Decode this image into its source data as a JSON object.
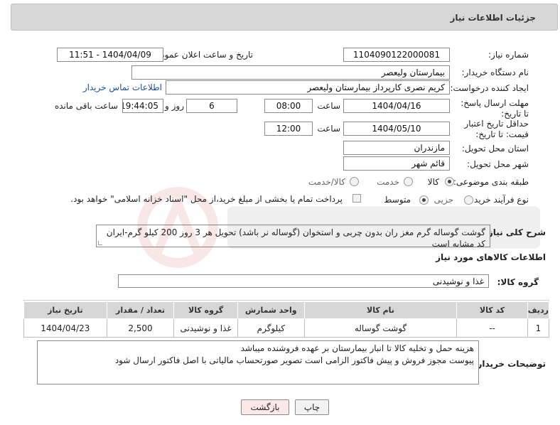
{
  "header": {
    "title": "جزئیات اطلاعات نیاز"
  },
  "fields": {
    "need_number_label": "شماره نیاز:",
    "need_number": "1104090122000081",
    "announce_label": "تاریخ و ساعت اعلان عمومی:",
    "announce_value": "1404/04/09 - 11:51",
    "buyer_org_label": "نام دستگاه خریدار:",
    "buyer_org": "بیمارستان ولیعصر",
    "creator_label": "ایجاد کننده درخواست:",
    "creator": "کریم نصری کارپرداز بیمارستان ولیعصر",
    "contact_link": "اطلاعات تماس خریدار",
    "reply_deadline_label": "مهلت ارسال پاسخ: تا تاریخ:",
    "reply_date": "1404/04/16",
    "time_label": "ساعت",
    "reply_time": "08:00",
    "days_value": "6",
    "days_label": "روز و",
    "remaining_time": "19:44:05",
    "remaining_label": "ساعت باقی مانده",
    "price_validity_label": "حداقل تاریخ اعتبار قیمت: تا تاریخ:",
    "price_date": "1404/05/10",
    "price_time": "12:00",
    "province_label": "استان محل تحویل:",
    "province": "مازندران",
    "city_label": "شهر محل تحویل:",
    "city": "قائم شهر",
    "category_label": "طبقه بندی موضوعی:",
    "category_options": [
      "کالا",
      "خدمت",
      "کالا/خدمت"
    ],
    "process_label": "نوع فرآیند خرید :",
    "process_options": [
      "جزیی",
      "متوسط"
    ],
    "payment_note": "پرداخت تمام یا بخشی از مبلغ خرید،از محل \"اسناد خزانه اسلامی\" خواهد بود."
  },
  "description": {
    "label": "شرح کلی نیاز:",
    "text": "گوشت گوساله گرم مغز ران بدون چربی و استخوان (گوساله نر باشد) تحویل هر 3 روز 200 کیلو گرم-ایران کد مشابه است"
  },
  "goods_info": {
    "title": "اطلاعات کالاهای مورد نیاز",
    "group_label": "گروه کالا:",
    "group_value": "غذا و نوشیدنی"
  },
  "table": {
    "headers": [
      "ردیف",
      "کد کالا",
      "نام کالا",
      "واحد شمارش",
      "گروه کالا",
      "تعداد / مقدار",
      "تاریخ نیاز"
    ],
    "rows": [
      [
        "1",
        "--",
        "گوشت گوساله",
        "کیلوگرم",
        "غذا و نوشیدنی",
        "2,500",
        "1404/04/23"
      ]
    ]
  },
  "buyer_notes": {
    "label": "توضیحات خریدار:",
    "line1": "هزینه حمل و تخلیه کالا تا انبار بیمارستان بر عهده فروشنده میباشد",
    "line2": "پیوست مجوز فروش و پیش فاکتور الزامی است  تصویر صورتحساب مالیاتی با اصل فاکتور ارسال شود"
  },
  "buttons": {
    "print": "چاپ",
    "back": "بازگشت"
  },
  "colors": {
    "header_bg": "#d7d7d7",
    "link": "#1a4fa0",
    "back_button_bg": "#fde8e8"
  }
}
